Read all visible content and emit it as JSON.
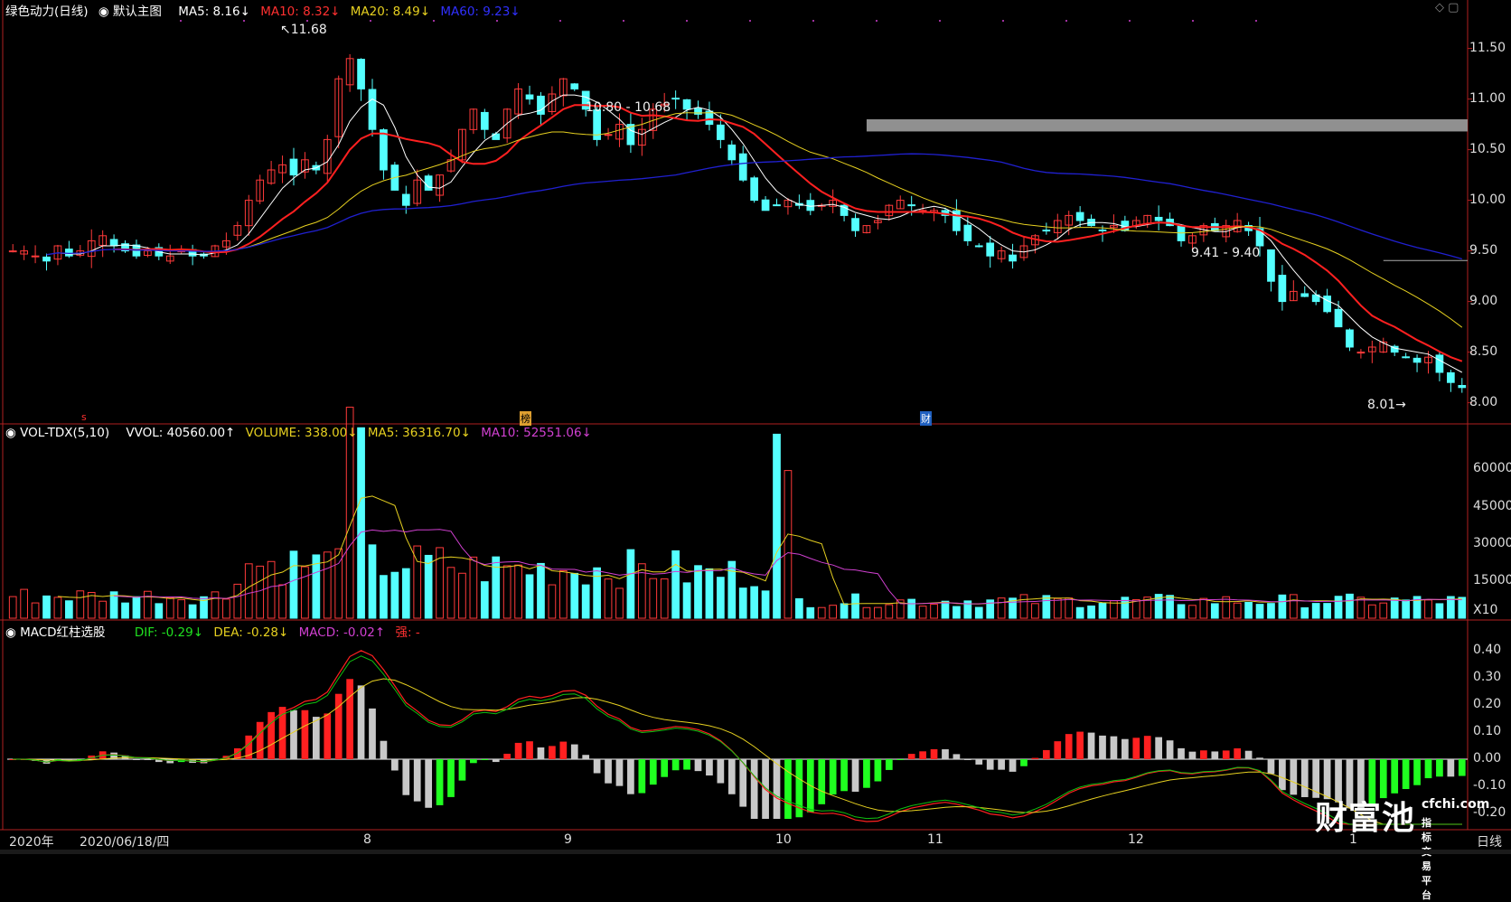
{
  "panels": {
    "price": {
      "stock_name": "绿色动力(日线)",
      "main_view": "默认主图",
      "ma5": "MA5: 8.16↓",
      "ma10": "MA10: 8.32↓",
      "ma20": "MA20: 8.49↓",
      "ma60": "MA60: 9.23↓",
      "y_ticks": [
        "11.50",
        "11.00",
        "10.50",
        "10.00",
        "9.50",
        "9.00",
        "8.50",
        "8.00"
      ],
      "annotations": {
        "high": "11.68",
        "low": "8.01",
        "zone1": "10.80 - 10.68",
        "zone2": "9.41 - 9.40"
      },
      "markers": [
        "s",
        "榜",
        "财"
      ]
    },
    "volume": {
      "name": "VOL-TDX(5,10)",
      "vvol": "VVOL: 40560.00↑",
      "volume": "VOLUME: 338.00↓",
      "ma5": "MA5: 36316.70↓",
      "ma10": "MA10: 52551.06↓",
      "y_ticks": [
        "60000",
        "45000",
        "30000",
        "15000"
      ],
      "unit": "X10"
    },
    "macd": {
      "name": "MACD红柱选股",
      "dif": "DIF: -0.29↓",
      "dea": "DEA: -0.28↓",
      "macd": "MACD: -0.02↑",
      "strong": "强: -",
      "y_ticks": [
        "0.40",
        "0.30",
        "0.20",
        "0.10",
        "0.00",
        "-0.10",
        "-0.20"
      ]
    }
  },
  "x_axis": {
    "labels": [
      "2020年",
      "2020/06/18/四",
      "8",
      "9",
      "10",
      "11",
      "12",
      "1"
    ],
    "period": "日线"
  },
  "brand": {
    "name": "财富池",
    "site": "cfchi.com",
    "tagline": "指标交易平台"
  },
  "colors": {
    "up": "#ff3a3a",
    "down": "#54ffff",
    "ma5": "#ffffff",
    "ma10": "#ff2020",
    "ma20": "#e6d020",
    "ma60": "#2020d0",
    "vol_ma10": "#d040d0",
    "dif": "#10c010",
    "dea": "#e6d020",
    "macd_up": "#ff2020",
    "macd_down": "#20ff20",
    "macd_gray": "#c8c8c8",
    "zone": "#909090"
  },
  "chart_data": [
    {
      "type": "candlestick",
      "title": "绿色动力(日线)",
      "ylim": [
        7.8,
        11.8
      ],
      "close_path": [
        9.5,
        9.5,
        9.45,
        9.4,
        9.55,
        9.45,
        9.5,
        9.6,
        9.65,
        9.55,
        9.5,
        9.45,
        9.5,
        9.45,
        9.45,
        9.5,
        9.45,
        9.45,
        9.55,
        9.6,
        9.75,
        10.0,
        10.2,
        10.3,
        10.35,
        10.25,
        10.4,
        10.3,
        10.6,
        11.2,
        11.4,
        11.1,
        10.7,
        10.3,
        10.1,
        9.95,
        10.2,
        10.1,
        10.25,
        10.4,
        10.7,
        10.9,
        10.7,
        10.6,
        10.9,
        11.1,
        11.0,
        10.85,
        11.05,
        11.2,
        11.1,
        10.9,
        10.6,
        10.65,
        10.75,
        10.55,
        10.7,
        10.9,
        10.95,
        11.0,
        10.9,
        10.85,
        10.75,
        10.6,
        10.4,
        10.2,
        10.0,
        9.9,
        9.95,
        10.0,
        9.95,
        9.9,
        9.95,
        10.0,
        9.85,
        9.7,
        9.75,
        9.8,
        9.95,
        10.0,
        9.95,
        9.9,
        9.9,
        9.85,
        9.7,
        9.6,
        9.55,
        9.45,
        9.5,
        9.4,
        9.55,
        9.65,
        9.7,
        9.8,
        9.85,
        9.8,
        9.75,
        9.7,
        9.75,
        9.7,
        9.8,
        9.85,
        9.8,
        9.75,
        9.6,
        9.65,
        9.75,
        9.7,
        9.75,
        9.8,
        9.7,
        9.55,
        9.2,
        9.0,
        9.1,
        9.05,
        9.0,
        8.9,
        8.75,
        8.55,
        8.5,
        8.55,
        8.6,
        8.5,
        8.45,
        8.4,
        8.45,
        8.3,
        8.2,
        8.15
      ]
    },
    {
      "type": "bar",
      "title": "VOL-TDX(5,10)",
      "ylim": [
        0,
        70000
      ]
    },
    {
      "type": "bar",
      "title": "MACD红柱选股",
      "ylim": [
        -0.25,
        0.45
      ]
    }
  ]
}
